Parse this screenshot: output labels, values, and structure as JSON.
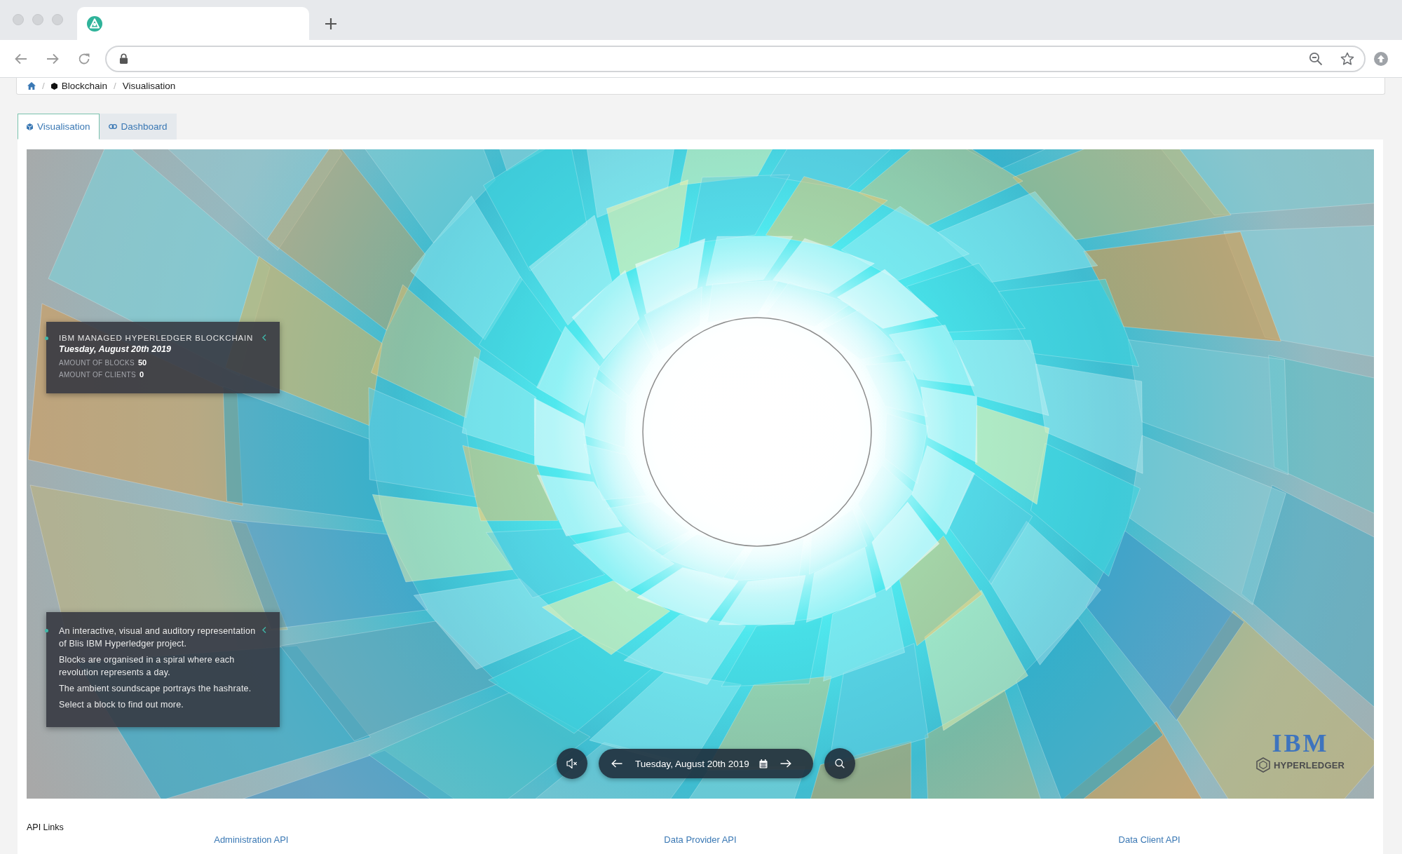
{
  "breadcrumb": {
    "separator": "/",
    "items": [
      {
        "kind": "home"
      },
      {
        "kind": "link",
        "label": "Blockchain"
      },
      {
        "kind": "current",
        "label": "Visualisation"
      }
    ]
  },
  "tabs": [
    {
      "label": "Visualisation",
      "selected": true
    },
    {
      "label": "Dashboard",
      "selected": false
    }
  ],
  "visualisation": {
    "info_panel": {
      "title": "IBM MANAGED HYPERLEDGER BLOCKCHAIN",
      "date": "Tuesday, August 20th 2019",
      "stats": [
        {
          "label": "AMOUNT OF BLOCKS",
          "value": "50"
        },
        {
          "label": "AMOUNT OF CLIENTS",
          "value": "0"
        }
      ]
    },
    "about_panel": {
      "paragraphs": [
        "An interactive, visual and auditory representation of Blis IBM Hyperledger project.",
        "Blocks are organised in a spiral where each revolution represents a day.",
        "The ambient soundscape portrays the hashrate.",
        "Select a block to find out more."
      ]
    },
    "controls": {
      "muted": true,
      "date": "Tuesday, August 20th 2019"
    },
    "logo": {
      "brand": "IBM",
      "product": "HYPERLEDGER"
    }
  },
  "api_links": {
    "title": "API Links",
    "links": [
      "Administration API",
      "Data Provider API",
      "Data Client API"
    ]
  }
}
